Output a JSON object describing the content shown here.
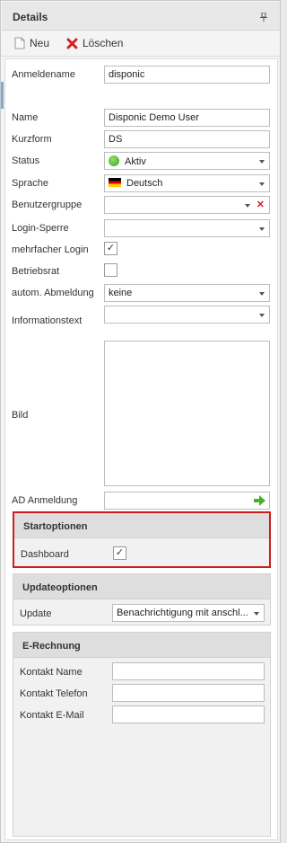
{
  "panel": {
    "title": "Details"
  },
  "toolbar": {
    "new_label": "Neu",
    "delete_label": "Löschen"
  },
  "form": {
    "login_name": {
      "label": "Anmeldename",
      "value": "disponic"
    },
    "name": {
      "label": "Name",
      "value": "Disponic Demo User"
    },
    "short_form": {
      "label": "Kurzform",
      "value": "DS"
    },
    "status": {
      "label": "Status",
      "value": "Aktiv",
      "icon": "green-status-icon"
    },
    "language": {
      "label": "Sprache",
      "value": "Deutsch",
      "icon": "german-flag-icon"
    },
    "user_group": {
      "label": "Benutzergruppe",
      "value": ""
    },
    "login_lock": {
      "label": "Login-Sperre",
      "value": ""
    },
    "multi_login": {
      "label": "mehrfacher Login",
      "checked": true
    },
    "works_council": {
      "label": "Betriebsrat",
      "checked": false
    },
    "auto_logout": {
      "label": "autom. Abmeldung",
      "value": "keine"
    },
    "info_text": {
      "label": "Informationstext",
      "value": ""
    },
    "picture": {
      "label": "Bild"
    },
    "ad_login": {
      "label": "AD Anmeldung",
      "value": ""
    }
  },
  "start_options": {
    "header": "Startoptionen",
    "dashboard": {
      "label": "Dashboard",
      "checked": true
    }
  },
  "update_options": {
    "header": "Updateoptionen",
    "update": {
      "label": "Update",
      "value": "Benachrichtigung mit anschl..."
    }
  },
  "e_invoice": {
    "header": "E-Rechnung",
    "contact_name": {
      "label": "Kontakt Name",
      "value": ""
    },
    "contact_phone": {
      "label": "Kontakt Telefon",
      "value": ""
    },
    "contact_email": {
      "label": "Kontakt E-Mail",
      "value": ""
    }
  },
  "colors": {
    "highlight": "#cc1e1e",
    "delete_icon": "#d42020",
    "go_arrow": "#4caf2a",
    "status_green": "#3ea51f"
  }
}
